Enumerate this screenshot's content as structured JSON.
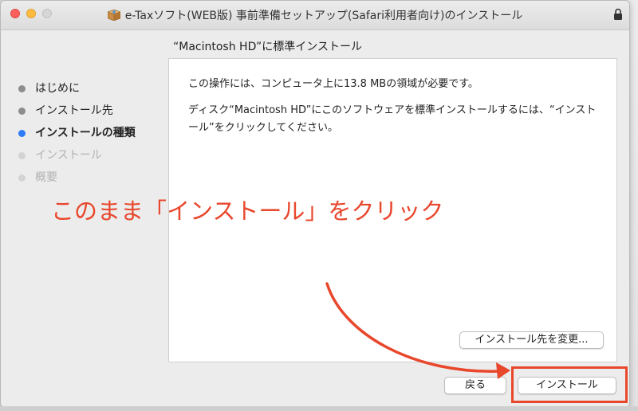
{
  "window": {
    "title": "e-Taxソフト(WEB版) 事前準備セットアップ(Safari利用者向け)のインストール",
    "subtitle": "“Macintosh HD”に標準インストール"
  },
  "sidebar": {
    "steps": [
      {
        "label": "はじめに",
        "state": "done"
      },
      {
        "label": "インストール先",
        "state": "done"
      },
      {
        "label": "インストールの種類",
        "state": "active"
      },
      {
        "label": "インストール",
        "state": "disabled"
      },
      {
        "label": "概要",
        "state": "disabled"
      }
    ]
  },
  "content": {
    "message1": "この操作には、コンピュータ上に13.8 MBの領域が必要です。",
    "message2": "ディスク“Macintosh HD”にこのソフトウェアを標準インストールするには、“インストール”をクリックしてください。",
    "change_location_label": "インストール先を変更..."
  },
  "footer": {
    "back_label": "戻る",
    "install_label": "インストール"
  },
  "annotation": {
    "text": "このまま「インストール」をクリック",
    "color": "#e8472c"
  },
  "colors": {
    "accent": "#2f7bf5",
    "annotation": "#e8472c"
  }
}
